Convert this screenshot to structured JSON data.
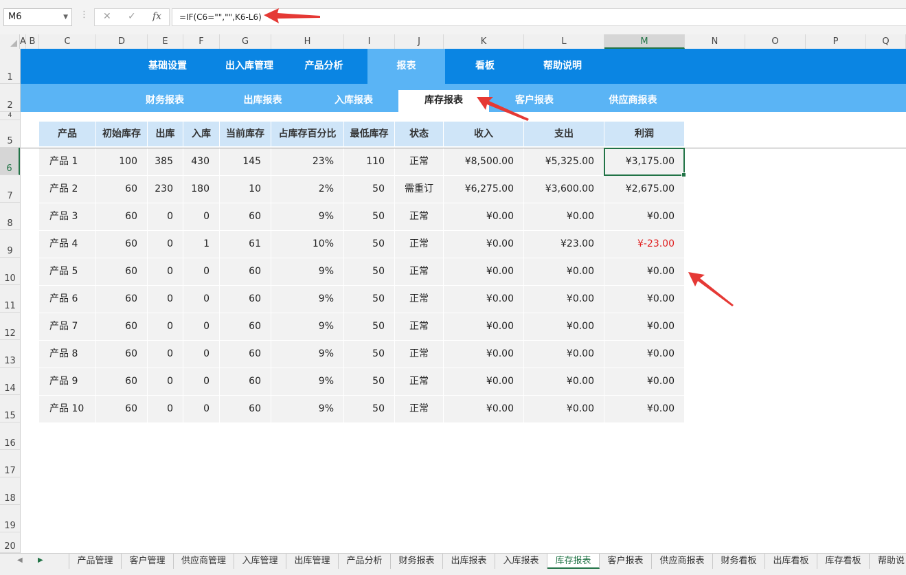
{
  "formula_bar": {
    "name_box": "M6",
    "cancel_icon": "✕",
    "enter_icon": "✓",
    "fx_icon": "fx",
    "formula": "=IF(C6=\"\",\"\",K6-L6)"
  },
  "columns": [
    "A",
    "B",
    "C",
    "D",
    "E",
    "F",
    "G",
    "H",
    "I",
    "J",
    "K",
    "L",
    "M",
    "N",
    "O",
    "P",
    "Q"
  ],
  "rows": [
    "1",
    "2",
    "4",
    "5",
    "6",
    "7",
    "8",
    "9",
    "10",
    "11",
    "12",
    "13",
    "14",
    "15",
    "16",
    "17",
    "18",
    "19",
    "20"
  ],
  "nav_main": [
    "基础设置",
    "出入库管理",
    "产品分析",
    "报表",
    "看板",
    "帮助说明"
  ],
  "nav_main_active": "报表",
  "nav_sub": [
    "财务报表",
    "出库报表",
    "入库报表",
    "库存报表",
    "客户报表",
    "供应商报表"
  ],
  "nav_sub_active": "库存报表",
  "table": {
    "headers": [
      "产品",
      "初始库存",
      "出库",
      "入库",
      "当前库存",
      "占库存百分比",
      "最低库存",
      "状态",
      "收入",
      "支出",
      "利润"
    ],
    "rows": [
      [
        "产品 1",
        "100",
        "385",
        "430",
        "145",
        "23%",
        "110",
        "正常",
        "¥8,500.00",
        "¥5,325.00",
        "¥3,175.00"
      ],
      [
        "产品 2",
        "60",
        "230",
        "180",
        "10",
        "2%",
        "50",
        "需重订",
        "¥6,275.00",
        "¥3,600.00",
        "¥2,675.00"
      ],
      [
        "产品 3",
        "60",
        "0",
        "0",
        "60",
        "9%",
        "50",
        "正常",
        "¥0.00",
        "¥0.00",
        "¥0.00"
      ],
      [
        "产品 4",
        "60",
        "0",
        "1",
        "61",
        "10%",
        "50",
        "正常",
        "¥0.00",
        "¥23.00",
        "¥-23.00"
      ],
      [
        "产品 5",
        "60",
        "0",
        "0",
        "60",
        "9%",
        "50",
        "正常",
        "¥0.00",
        "¥0.00",
        "¥0.00"
      ],
      [
        "产品 6",
        "60",
        "0",
        "0",
        "60",
        "9%",
        "50",
        "正常",
        "¥0.00",
        "¥0.00",
        "¥0.00"
      ],
      [
        "产品 7",
        "60",
        "0",
        "0",
        "60",
        "9%",
        "50",
        "正常",
        "¥0.00",
        "¥0.00",
        "¥0.00"
      ],
      [
        "产品 8",
        "60",
        "0",
        "0",
        "60",
        "9%",
        "50",
        "正常",
        "¥0.00",
        "¥0.00",
        "¥0.00"
      ],
      [
        "产品 9",
        "60",
        "0",
        "0",
        "60",
        "9%",
        "50",
        "正常",
        "¥0.00",
        "¥0.00",
        "¥0.00"
      ],
      [
        "产品 10",
        "60",
        "0",
        "0",
        "60",
        "9%",
        "50",
        "正常",
        "¥0.00",
        "¥0.00",
        "¥0.00"
      ]
    ]
  },
  "sheet_tabs": [
    "产品管理",
    "客户管理",
    "供应商管理",
    "入库管理",
    "出库管理",
    "产品分析",
    "财务报表",
    "出库报表",
    "入库报表",
    "库存报表",
    "客户报表",
    "供应商报表",
    "财务看板",
    "出库看板",
    "库存看板",
    "帮助说"
  ],
  "sheet_tab_active": "库存报表",
  "colors": {
    "nav_main_bg": "#0a85e3",
    "nav_sub_bg": "#5ab4f5",
    "header_bg": "#cfe5f8",
    "cell_bg": "#f2f2f2",
    "negative": "#e02020",
    "selection": "#217346",
    "arrow": "#e53935"
  }
}
